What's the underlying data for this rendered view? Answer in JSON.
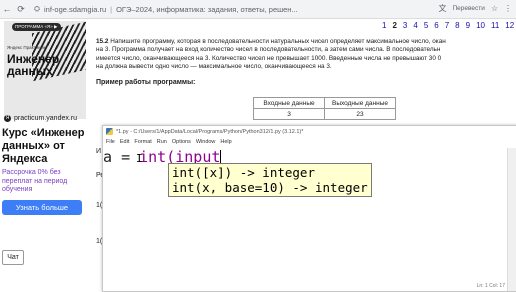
{
  "browser": {
    "url_host": "inf-oge.sdamgia.ru",
    "page_title": "ОГЭ–2024, информатика: задания, ответы, решен...",
    "translate_label": "Перевести"
  },
  "ad": {
    "banner_pill": "ПРОГРАММА «Я» ▶",
    "banner_caption": "Яндекс Практикум",
    "banner_big": "Инженер данных",
    "source": "practicum.yandex.ru",
    "title": "Курс «Инженер данных» от Яндекса",
    "promo": "Рассрочка 0% без переплат на период обучения",
    "button": "Узнать больше",
    "chat": "Чат"
  },
  "pagination": {
    "pages": [
      "1",
      "2",
      "3",
      "4",
      "5",
      "6",
      "7",
      "8",
      "9",
      "10",
      "11",
      "12"
    ],
    "current": "2"
  },
  "task": {
    "number": "15.2",
    "lines": [
      "Напишите программу, которая в последовательности натуральных чисел определяет максимальное число, окан",
      "на 3. Программа получает на вход количество чисел в последовательности, а затем сами числа. В последовательн",
      "имеется число, оканчивающееся на 3. Количество чисел не превышает 1000. Введенные числа не превышают 30 0",
      "на должна вывести одно число — максимальное число, оканчивающееся на 3."
    ],
    "example_label": "Пример работы программы:",
    "table_headers": [
      "Входные данные",
      "Выходные данные"
    ],
    "table_row": [
      "3",
      "23"
    ],
    "bg_fragments": [
      "И",
      "Ре",
      "1(",
      "1("
    ]
  },
  "idle": {
    "title": "*1.py - C:/Users/1/AppData/Local/Programs/Python/Python312/1.py (3.12.1)*",
    "menu": [
      "File",
      "Edit",
      "Format",
      "Run",
      "Options",
      "Window",
      "Help"
    ],
    "code_var": "a",
    "code_eq": "=",
    "code_call": "int(input",
    "calltip": [
      "int([x]) -> integer",
      "int(x, base=10) -> integer"
    ],
    "status": "Ln: 1  Col: 17"
  }
}
